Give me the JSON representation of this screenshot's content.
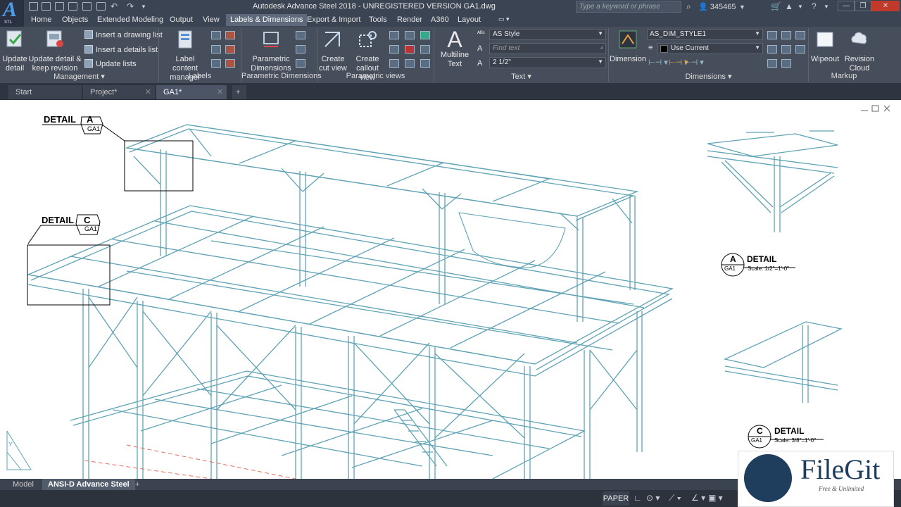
{
  "titlebar": {
    "app_letter": "A",
    "app_sub": "STL",
    "title": "Autodesk Advance Steel 2018 - UNREGISTERED VERSION    GA1.dwg",
    "search_placeholder": "Type a keyword or phrase",
    "user": "345465"
  },
  "ribbon_tabs": [
    "Home",
    "Objects",
    "Extended Modeling",
    "Output",
    "View",
    "Labels & Dimensions",
    "Export & Import",
    "Tools",
    "Render",
    "A360",
    "Layout"
  ],
  "active_tab": "Labels & Dimensions",
  "ribbon": {
    "management": {
      "title": "Management",
      "update_detail": "Update detail",
      "update_keep": "Update detail & keep revision",
      "insert_drawing_list": "Insert a drawing list",
      "insert_details_list": "Insert a details list",
      "update_lists": "Update lists"
    },
    "labels": {
      "title": "Labels",
      "label_content_manager": "Label content manager"
    },
    "parametric_dimensions": {
      "title": "Parametric Dimensions",
      "button": "Parametric Dimensions"
    },
    "parametric_views": {
      "title": "Parametric views",
      "create_cut_view": "Create cut view",
      "create_callout_view": "Create callout view"
    },
    "text": {
      "title": "Text",
      "multiline_text": "Multiline Text",
      "text_style": "AS Style",
      "find_text_placeholder": "Find text",
      "text_height": "2 1/2\""
    },
    "dimensions": {
      "title": "Dimensions",
      "dimension": "Dimension",
      "dim_style": "AS_DIM_STYLE1",
      "layer": "Use Current"
    },
    "markup": {
      "title": "Markup",
      "wipeout": "Wipeout",
      "revision_cloud": "Revision Cloud"
    }
  },
  "doc_tabs": [
    "Start",
    "Project*",
    "GA1*"
  ],
  "active_doc": "GA1*",
  "drawing": {
    "detail_a_callout": {
      "word": "DETAIL",
      "letter": "A",
      "sheet": "GA1"
    },
    "detail_c_callout": {
      "word": "DETAIL",
      "letter": "C",
      "sheet": "GA1"
    },
    "detail_a_title": {
      "letter": "A",
      "sheet": "GA1",
      "word": "DETAIL",
      "scale": "Scale: 1/2\"=1'-0\""
    },
    "detail_c_title": {
      "letter": "C",
      "sheet": "GA1",
      "word": "DETAIL",
      "scale": "Scale: 3/8\"=1'-0\""
    },
    "ucs": "Y"
  },
  "layout_tabs": [
    "Model",
    "ANSI-D Advance Steel"
  ],
  "active_layout": "ANSI-D Advance Steel",
  "status": {
    "paper": "PAPER"
  },
  "watermark": {
    "name": "FileGit",
    "tagline": "Free & Unlimited"
  },
  "colors": {
    "accent": "#5e6a7c",
    "steel_line": "#5fa3b4",
    "dark_ui": "#464e5c"
  }
}
